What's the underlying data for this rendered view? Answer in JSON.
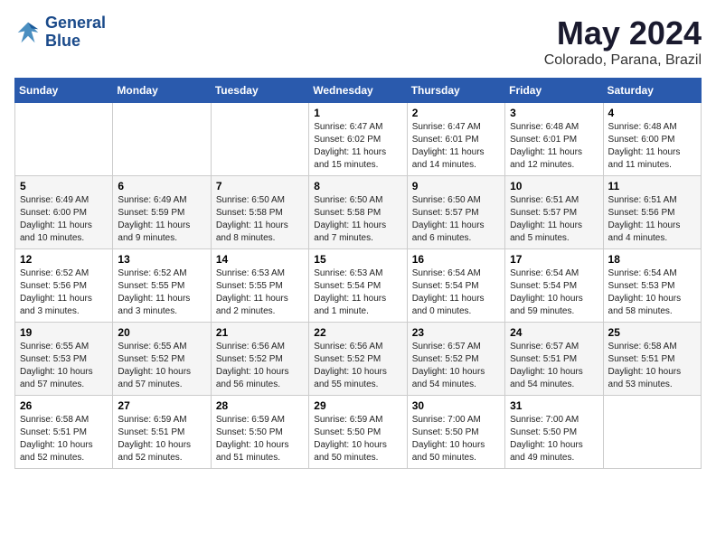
{
  "logo": {
    "line1": "General",
    "line2": "Blue"
  },
  "title": "May 2024",
  "subtitle": "Colorado, Parana, Brazil",
  "days_of_week": [
    "Sunday",
    "Monday",
    "Tuesday",
    "Wednesday",
    "Thursday",
    "Friday",
    "Saturday"
  ],
  "weeks": [
    [
      {
        "day": "",
        "info": ""
      },
      {
        "day": "",
        "info": ""
      },
      {
        "day": "",
        "info": ""
      },
      {
        "day": "1",
        "info": "Sunrise: 6:47 AM\nSunset: 6:02 PM\nDaylight: 11 hours and 15 minutes."
      },
      {
        "day": "2",
        "info": "Sunrise: 6:47 AM\nSunset: 6:01 PM\nDaylight: 11 hours and 14 minutes."
      },
      {
        "day": "3",
        "info": "Sunrise: 6:48 AM\nSunset: 6:01 PM\nDaylight: 11 hours and 12 minutes."
      },
      {
        "day": "4",
        "info": "Sunrise: 6:48 AM\nSunset: 6:00 PM\nDaylight: 11 hours and 11 minutes."
      }
    ],
    [
      {
        "day": "5",
        "info": "Sunrise: 6:49 AM\nSunset: 6:00 PM\nDaylight: 11 hours and 10 minutes."
      },
      {
        "day": "6",
        "info": "Sunrise: 6:49 AM\nSunset: 5:59 PM\nDaylight: 11 hours and 9 minutes."
      },
      {
        "day": "7",
        "info": "Sunrise: 6:50 AM\nSunset: 5:58 PM\nDaylight: 11 hours and 8 minutes."
      },
      {
        "day": "8",
        "info": "Sunrise: 6:50 AM\nSunset: 5:58 PM\nDaylight: 11 hours and 7 minutes."
      },
      {
        "day": "9",
        "info": "Sunrise: 6:50 AM\nSunset: 5:57 PM\nDaylight: 11 hours and 6 minutes."
      },
      {
        "day": "10",
        "info": "Sunrise: 6:51 AM\nSunset: 5:57 PM\nDaylight: 11 hours and 5 minutes."
      },
      {
        "day": "11",
        "info": "Sunrise: 6:51 AM\nSunset: 5:56 PM\nDaylight: 11 hours and 4 minutes."
      }
    ],
    [
      {
        "day": "12",
        "info": "Sunrise: 6:52 AM\nSunset: 5:56 PM\nDaylight: 11 hours and 3 minutes."
      },
      {
        "day": "13",
        "info": "Sunrise: 6:52 AM\nSunset: 5:55 PM\nDaylight: 11 hours and 3 minutes."
      },
      {
        "day": "14",
        "info": "Sunrise: 6:53 AM\nSunset: 5:55 PM\nDaylight: 11 hours and 2 minutes."
      },
      {
        "day": "15",
        "info": "Sunrise: 6:53 AM\nSunset: 5:54 PM\nDaylight: 11 hours and 1 minute."
      },
      {
        "day": "16",
        "info": "Sunrise: 6:54 AM\nSunset: 5:54 PM\nDaylight: 11 hours and 0 minutes."
      },
      {
        "day": "17",
        "info": "Sunrise: 6:54 AM\nSunset: 5:54 PM\nDaylight: 10 hours and 59 minutes."
      },
      {
        "day": "18",
        "info": "Sunrise: 6:54 AM\nSunset: 5:53 PM\nDaylight: 10 hours and 58 minutes."
      }
    ],
    [
      {
        "day": "19",
        "info": "Sunrise: 6:55 AM\nSunset: 5:53 PM\nDaylight: 10 hours and 57 minutes."
      },
      {
        "day": "20",
        "info": "Sunrise: 6:55 AM\nSunset: 5:52 PM\nDaylight: 10 hours and 57 minutes."
      },
      {
        "day": "21",
        "info": "Sunrise: 6:56 AM\nSunset: 5:52 PM\nDaylight: 10 hours and 56 minutes."
      },
      {
        "day": "22",
        "info": "Sunrise: 6:56 AM\nSunset: 5:52 PM\nDaylight: 10 hours and 55 minutes."
      },
      {
        "day": "23",
        "info": "Sunrise: 6:57 AM\nSunset: 5:52 PM\nDaylight: 10 hours and 54 minutes."
      },
      {
        "day": "24",
        "info": "Sunrise: 6:57 AM\nSunset: 5:51 PM\nDaylight: 10 hours and 54 minutes."
      },
      {
        "day": "25",
        "info": "Sunrise: 6:58 AM\nSunset: 5:51 PM\nDaylight: 10 hours and 53 minutes."
      }
    ],
    [
      {
        "day": "26",
        "info": "Sunrise: 6:58 AM\nSunset: 5:51 PM\nDaylight: 10 hours and 52 minutes."
      },
      {
        "day": "27",
        "info": "Sunrise: 6:59 AM\nSunset: 5:51 PM\nDaylight: 10 hours and 52 minutes."
      },
      {
        "day": "28",
        "info": "Sunrise: 6:59 AM\nSunset: 5:50 PM\nDaylight: 10 hours and 51 minutes."
      },
      {
        "day": "29",
        "info": "Sunrise: 6:59 AM\nSunset: 5:50 PM\nDaylight: 10 hours and 50 minutes."
      },
      {
        "day": "30",
        "info": "Sunrise: 7:00 AM\nSunset: 5:50 PM\nDaylight: 10 hours and 50 minutes."
      },
      {
        "day": "31",
        "info": "Sunrise: 7:00 AM\nSunset: 5:50 PM\nDaylight: 10 hours and 49 minutes."
      },
      {
        "day": "",
        "info": ""
      }
    ]
  ]
}
